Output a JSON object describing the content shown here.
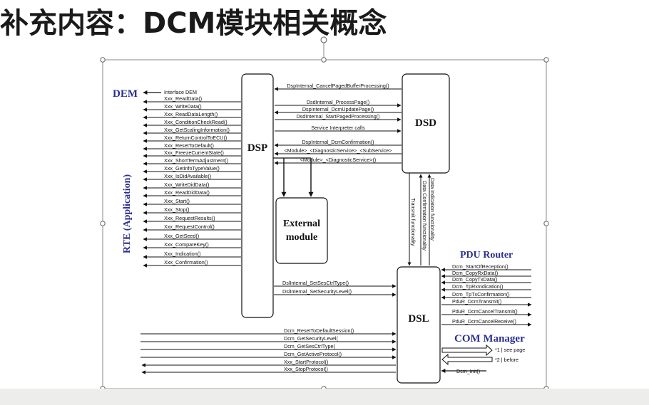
{
  "title": "补充内容：DCM模块相关概念",
  "blocks": {
    "dsp": "DSP",
    "dsd": "DSD",
    "dsl": "DSL",
    "external_line1": "External",
    "external_line2": "module"
  },
  "groups": {
    "dem": "DEM",
    "rte": "RTE (Application)",
    "pdu_router": "PDU Router",
    "com_manager": "COM Manager"
  },
  "dem_interface": "Interface DEM",
  "rte_calls": [
    "Xxx_ReadData()",
    "Xxx_WriteData()",
    "Xxx_ReadDataLength()",
    "Xxx_ConditionCheckRead()",
    "Xxx_GetScalingInformation()",
    "Xxx_ReturnControlToECU()",
    "Xxx_ResetToDefault()",
    "Xxx_FreezeCurrentState()",
    "Xxx_ShortTermAdjustment()",
    "Xxx_GetInfoTypeValue()",
    "Xxx_IsDidAvailable()",
    "Xxx_WriteDidData()",
    "Xxx_ReadDidData()",
    "Xxx_Start()",
    "Xxx_Stop()",
    "Xxx_RequestResults()",
    "Xxx_RequestControl()",
    "Xxx_GetSeed()",
    "Xxx_CompareKey()",
    "Xxx_Indication()",
    "Xxx_Confirmation()"
  ],
  "dsp_dsd_calls": [
    "DspInternal_CancelPagedBufferProcessing()",
    "DsdInternal_ProcessPage()",
    "DspInternal_DcmUpdatePage()",
    "DsdInternal_StartPagedProcessing()",
    "Service Interpreter calls",
    "DspInternal_DcmConfirmation()",
    "<Module>_<DiagnosticService>_<SubService>",
    "<Module>_<DiagnosticService>()"
  ],
  "dsd_dsl_labels": [
    "Data Indication functionality",
    "Data Confirmation functionality",
    "Transmit functionality"
  ],
  "dsp_dsl_calls": [
    "DslInternal_SetSesCtrlType()",
    "DslInternal_SetSecurityLevel()"
  ],
  "app_dsl_calls": [
    "Dcm_ResetToDefaultSession()",
    "Dcm_GetSecurityLevel(",
    "Dcm_GetSesCtrlType(",
    "Dcm_GetActiveProtocol()",
    "Xxx_StartProtocol()",
    "Xxx_StopProtocol()"
  ],
  "pdu_calls": [
    "Dcm_StartOfReception()",
    "Dcm_CopyRxData()",
    "Dcm_CopyTxData()",
    "Dcm_TpRxIndication()",
    "Dcm_TpTxConfirmation()",
    "PduR_DcmTransmit()",
    "PduR_DcmCancelTransmit()",
    "PduR_DcmCancelReceive()"
  ],
  "com_notes": [
    "*1 | see page",
    "*2 | before"
  ],
  "com_init": "Dcm_Init()",
  "colors": {
    "accent_blue": "#2b2f8f",
    "bottom_bar": "#ededeb"
  }
}
